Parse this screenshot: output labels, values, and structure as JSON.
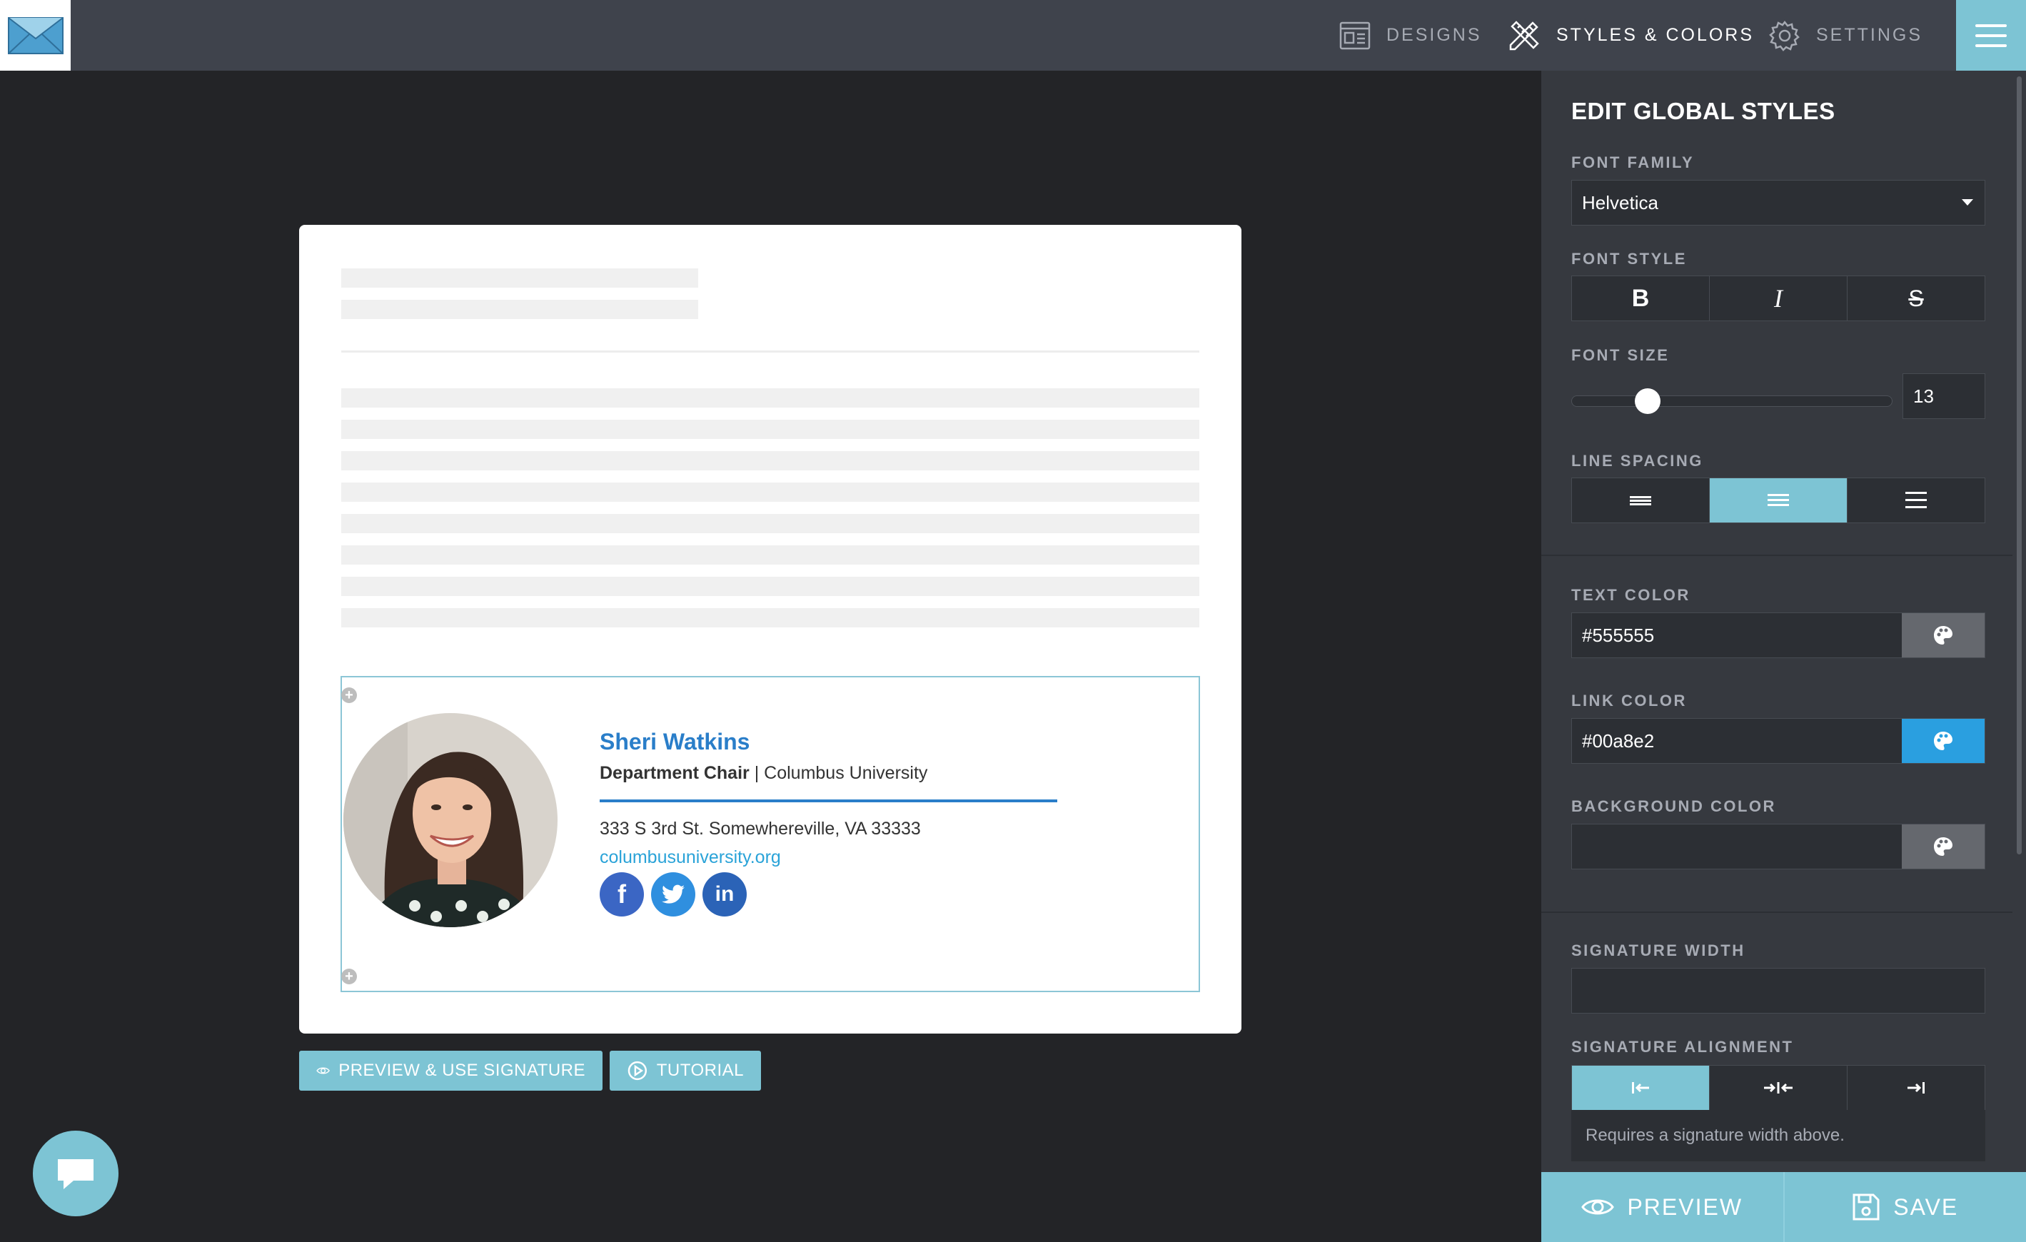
{
  "nav": {
    "designs": "DESIGNS",
    "styles_colors": "STYLES & COLORS",
    "settings": "SETTINGS"
  },
  "signature": {
    "name": "Sheri Watkins",
    "title": "Department Chair",
    "separator": " | ",
    "organization": "Columbus University",
    "address": "333 S 3rd St. Somewhereville, VA 33333",
    "website": "columbusuniversity.org",
    "social": [
      {
        "name": "facebook",
        "glyph": "f",
        "color": "#3b66c4"
      },
      {
        "name": "twitter",
        "glyph": "🐦",
        "color": "#2f8fdf"
      },
      {
        "name": "linkedin",
        "glyph": "in",
        "color": "#2b63b7"
      }
    ]
  },
  "canvas_buttons": {
    "preview_use": "PREVIEW & USE SIGNATURE",
    "tutorial": "TUTORIAL"
  },
  "panel": {
    "title": "EDIT GLOBAL STYLES",
    "font_family_label": "FONT FAMILY",
    "font_family_value": "Helvetica",
    "font_style_label": "FONT STYLE",
    "font_size_label": "FONT SIZE",
    "font_size_value": "13",
    "line_spacing_label": "LINE SPACING",
    "line_spacing_selected": "medium",
    "text_color_label": "TEXT COLOR",
    "text_color_value": "#555555",
    "link_color_label": "LINK COLOR",
    "link_color_value": "#00a8e2",
    "background_color_label": "BACKGROUND COLOR",
    "background_color_value": "",
    "signature_width_label": "SIGNATURE WIDTH",
    "signature_width_value": "",
    "signature_alignment_label": "SIGNATURE ALIGNMENT",
    "signature_alignment_selected": "left",
    "alignment_hint": "Requires a signature width above."
  },
  "footer": {
    "preview": "PREVIEW",
    "save": "SAVE"
  },
  "colors": {
    "accent": "#7dc4d4",
    "topbar": "#3f434c",
    "link": "#2a7ec9"
  }
}
